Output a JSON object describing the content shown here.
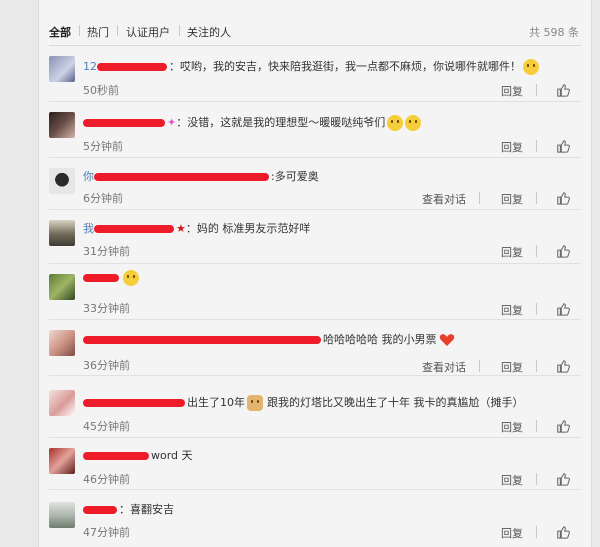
{
  "tabs": [
    {
      "label": "全部",
      "active": true
    },
    {
      "label": "热门",
      "active": false
    },
    {
      "label": "认证用户",
      "active": false
    },
    {
      "label": "关注的人",
      "active": false
    }
  ],
  "total": "共 598 条",
  "actions": {
    "reply": "回复",
    "view_conversation": "查看对话",
    "like_icon": "thumbs-up-icon"
  },
  "colors": {
    "redaction": "#ee1c2a",
    "link": "#4f7fb7",
    "background": "#f4f4f4"
  },
  "comments": [
    {
      "user_visible": "12",
      "text": "：哎哟，我的安吉，快来陪我逛街，我一点都不麻烦，你说哪件就哪件！",
      "time": "50秒前",
      "emoji": "emoji-face-icon",
      "view_conversation": false
    },
    {
      "user_visible": "",
      "text": "：没错，这就是我的理想型～暖暖哒纯爷们",
      "time": "5分钟前",
      "emoji": "emoji-smile-icon",
      "view_conversation": false
    },
    {
      "user_visible": "你",
      "text": ":多可爱奥",
      "time": "6分钟前",
      "emoji": "",
      "view_conversation": true
    },
    {
      "user_visible": "我",
      "text": "：妈的 标准男友示范好咩",
      "time": "31分钟前",
      "emoji": "",
      "view_conversation": false
    },
    {
      "user_visible": "",
      "text": "",
      "time": "33分钟前",
      "emoji": "emoji-face-icon",
      "view_conversation": false
    },
    {
      "user_visible": "",
      "text": "哈哈哈哈哈 我的小男票",
      "time": "36分钟前",
      "emoji": "heart-icon",
      "view_conversation": true
    },
    {
      "user_visible": "",
      "text": "出生了10年",
      "text2": "跟我的灯塔比又晚出生了十年 我卡的真尴尬（摊手）",
      "time": "45分钟前",
      "emoji": "doge-icon",
      "view_conversation": false
    },
    {
      "user_visible": "",
      "text": "word 天",
      "time": "46分钟前",
      "emoji": "",
      "view_conversation": false
    },
    {
      "user_visible": "",
      "text": "：喜翻安吉",
      "time": "47分钟前",
      "emoji": "",
      "view_conversation": false
    }
  ]
}
